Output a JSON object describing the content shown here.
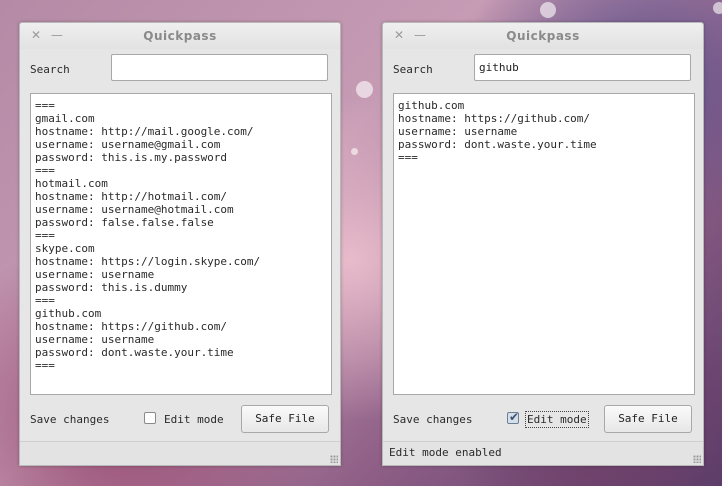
{
  "windows": [
    {
      "title": "Quickpass",
      "search_label": "Search",
      "search_value": "",
      "content": "===\ngmail.com\nhostname: http://mail.google.com/\nusername: username@gmail.com\npassword: this.is.my.password\n===\nhotmail.com\nhostname: http://hotmail.com/\nusername: username@hotmail.com\npassword: false.false.false\n===\nskype.com\nhostname: https://login.skype.com/\nusername: username\npassword: this.is.dummy\n===\ngithub.com\nhostname: https://github.com/\nusername: username\npassword: dont.waste.your.time\n===",
      "save_label": "Save changes",
      "edit_mode_label": "Edit mode",
      "edit_mode_checked": false,
      "safe_file_label": "Safe File",
      "status": ""
    },
    {
      "title": "Quickpass",
      "search_label": "Search",
      "search_value": "github",
      "content": "github.com\nhostname: https://github.com/\nusername: username\npassword: dont.waste.your.time\n===",
      "save_label": "Save changes",
      "edit_mode_label": "Edit mode",
      "edit_mode_checked": true,
      "safe_file_label": "Safe File",
      "status": "Edit mode enabled"
    }
  ],
  "icons": {
    "close": "close-icon",
    "minimize": "minimize-icon",
    "resize": "resize-grip-icon",
    "check": "checkmark-icon"
  }
}
